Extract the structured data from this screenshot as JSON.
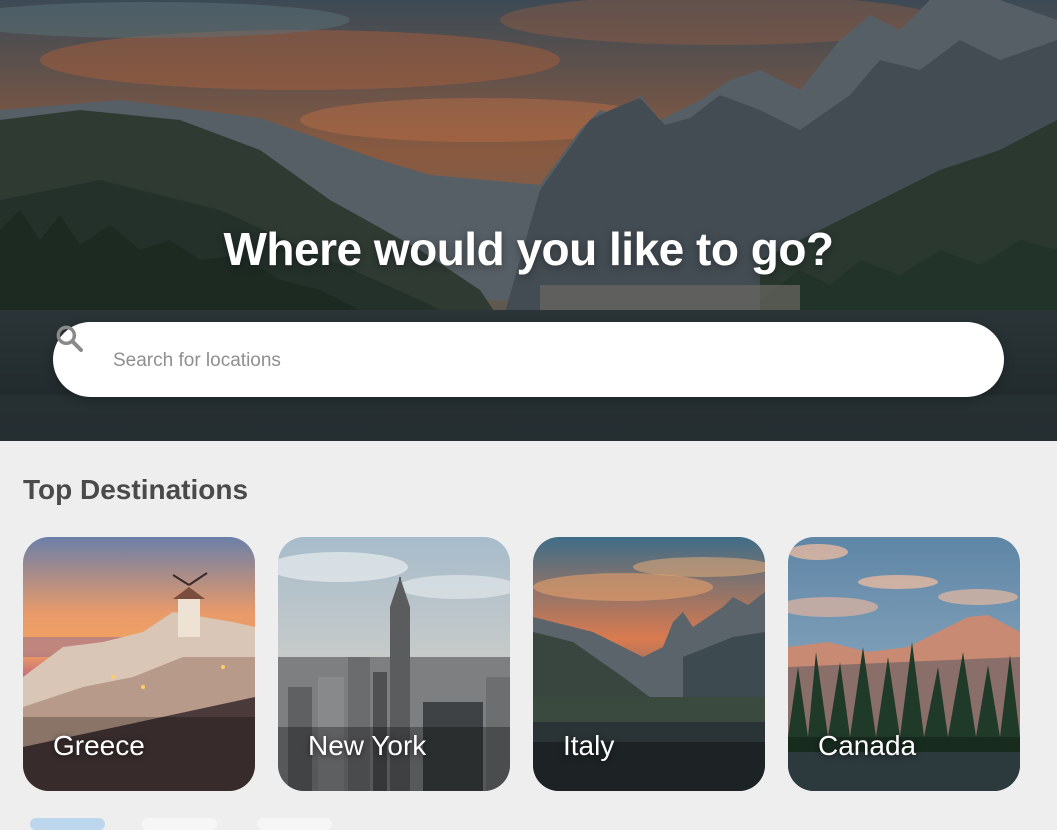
{
  "hero": {
    "title": "Where would you like to go?",
    "search": {
      "placeholder": "Search for locations",
      "value": "",
      "icon": "search-icon"
    }
  },
  "destinations": {
    "title": "Top Destinations",
    "items": [
      {
        "label": "Greece"
      },
      {
        "label": "New York"
      },
      {
        "label": "Italy"
      },
      {
        "label": "Canada"
      }
    ]
  },
  "colors": {
    "background": "#eeeeee",
    "search_bar": "#ffffff",
    "title_text": "#ffffff",
    "section_title": "#4a4a4a"
  }
}
